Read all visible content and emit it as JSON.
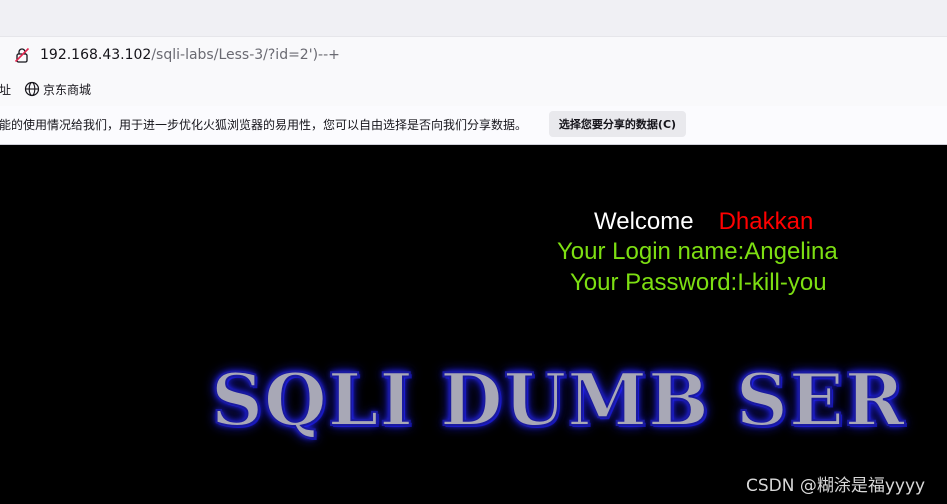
{
  "browser": {
    "url_host": "192.168.43.102",
    "url_path": "/sqli-labs/Less-3/?id=2')--+",
    "bookmarks": {
      "cut_label": "址",
      "jd_label": "京东商城"
    },
    "notification": {
      "text": "能的使用情况给我们，用于进一步优化火狐浏览器的易用性，您可以自由选择是否向我们分享数据。",
      "button_label": "选择您要分享的数据(C)"
    }
  },
  "page": {
    "welcome_label": "Welcome",
    "welcome_name": "Dhakkan",
    "login_line": "Your Login name:Angelina",
    "password_line": "Your Password:I-kill-you",
    "banner": "SQLI DUMB SER",
    "watermark": "CSDN @糊涂是福yyyy"
  },
  "colors": {
    "welcome": "#ffffff",
    "name": "#ff0000",
    "credentials": "#7ddf12"
  },
  "icons": {
    "urlbar_security": "insecure-lock-icon",
    "bookmark": "globe-icon"
  }
}
